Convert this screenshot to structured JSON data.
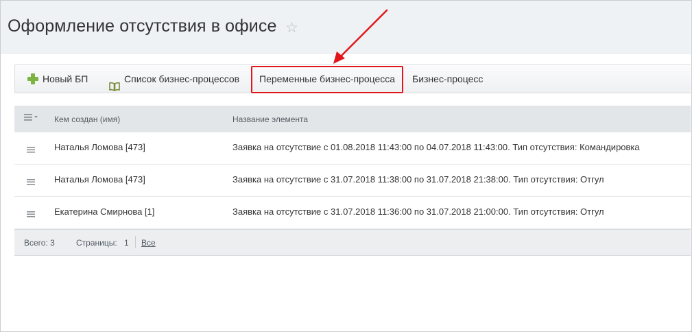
{
  "page": {
    "title": "Оформление отсутствия в офисе",
    "favorite_icon": "star-icon"
  },
  "toolbar": {
    "new_bp_label": "Новый БП",
    "new_bp_icon": "plus-icon",
    "bp_list_label": "Список бизнес-процессов",
    "bp_list_icon": "book-icon",
    "bp_vars_label": "Переменные бизнес-процесса",
    "bp_label": "Бизнес-процесс"
  },
  "annotation": {
    "highlight_color": "#e0161b",
    "target": "Переменные бизнес-процесса"
  },
  "grid": {
    "columns": {
      "settings_icon": "list-settings-icon",
      "author": "Кем создан (имя)",
      "name": "Название элемента"
    },
    "rows": [
      {
        "author": "Наталья Ломова [473]",
        "title": "Заявка на отсутствие с 01.08.2018 11:43:00 по 04.07.2018 11:43:00. Тип отсутствия: Командировка"
      },
      {
        "author": "Наталья Ломова [473]",
        "title": "Заявка на отсутствие с 31.07.2018 11:38:00 по 31.07.2018 21:38:00. Тип отсутствия: Отгул"
      },
      {
        "author": "Екатерина Смирнова [1]",
        "title": "Заявка на отсутствие с 31.07.2018 11:36:00 по 31.07.2018 21:00:00. Тип отсутствия: Отгул"
      }
    ],
    "footer": {
      "total": "Всего: 3",
      "pages_label": "Страницы:",
      "page_number": "1",
      "all_label": "Все"
    }
  },
  "colors": {
    "header_bg": "#eef2f4",
    "accent_plus": "#7cb342",
    "highlight_red": "#e0161b"
  }
}
